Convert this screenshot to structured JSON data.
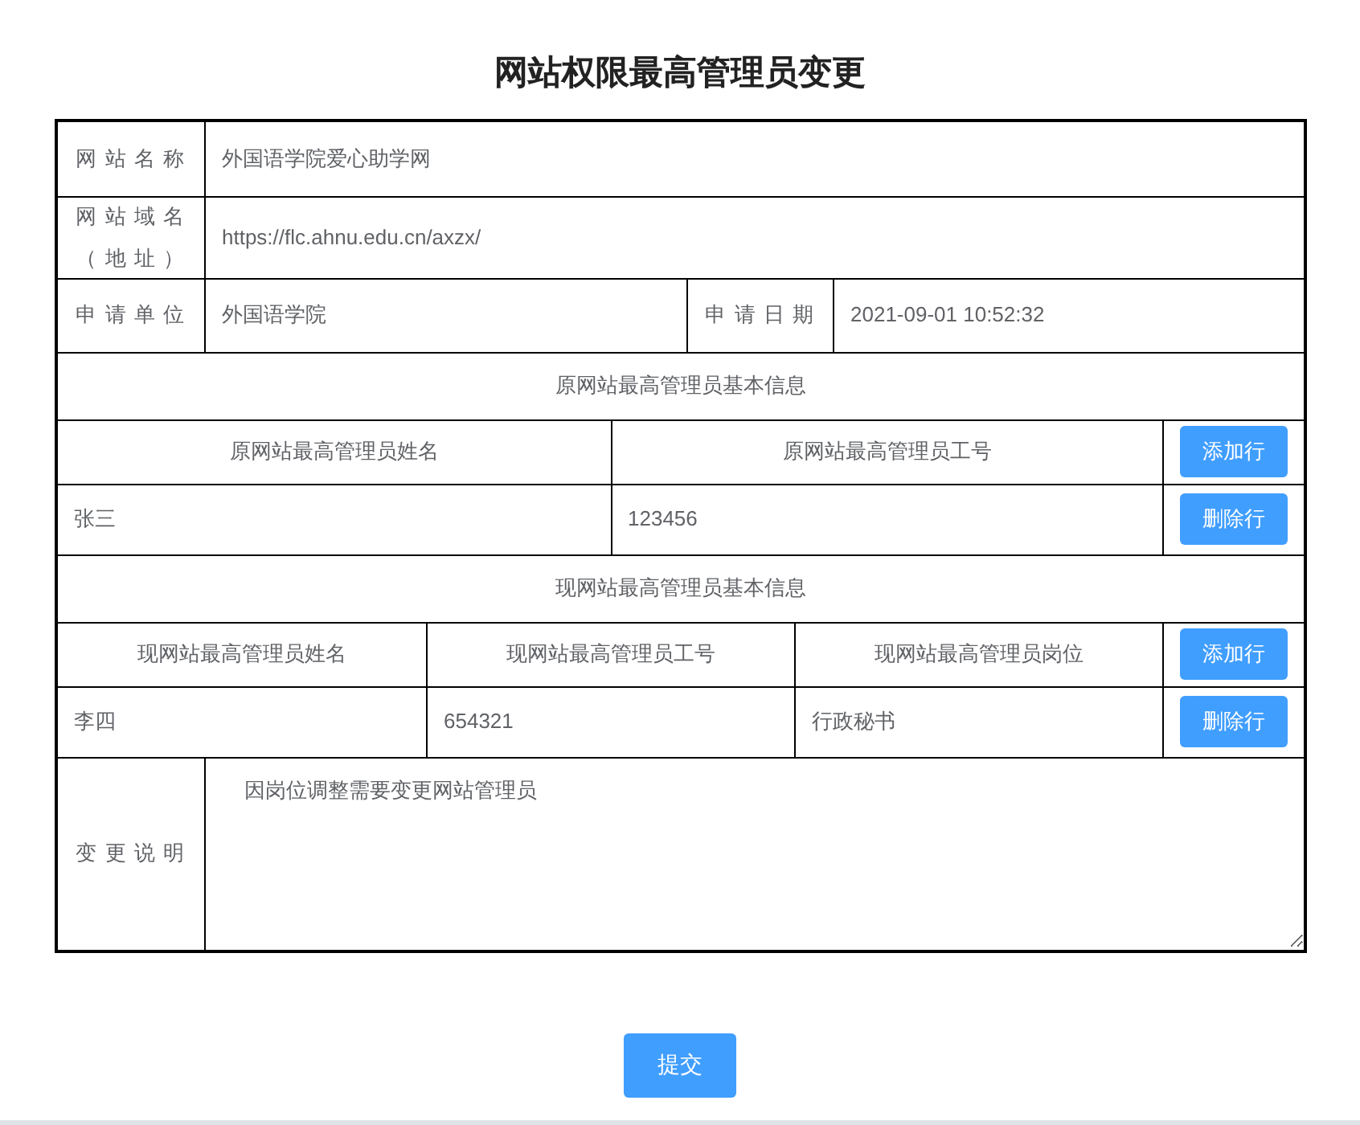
{
  "title": "网站权限最高管理员变更",
  "site_fields": [
    {
      "label": "网站名称",
      "value": "外国语学院爱心助学网"
    },
    {
      "label": "网站域名（地址）",
      "value": "https://flc.ahnu.edu.cn/axzx/"
    }
  ],
  "apply_row": [
    {
      "label": "申请单位",
      "value": "外国语学院"
    },
    {
      "label": "申请日期",
      "value": "2021-09-01 10:52:32"
    }
  ],
  "sections": [
    {
      "heading": "原网站最高管理员基本信息",
      "columns": [
        "原网站最高管理员姓名",
        "原网站最高管理员工号"
      ],
      "add_button": "添加行",
      "rows": [
        {
          "cells": [
            "张三",
            "123456"
          ],
          "delete_button": "删除行"
        }
      ]
    },
    {
      "heading": "现网站最高管理员基本信息",
      "columns": [
        "现网站最高管理员姓名",
        "现网站最高管理员工号",
        "现网站最高管理员岗位"
      ],
      "add_button": "添加行",
      "rows": [
        {
          "cells": [
            "李四",
            "654321",
            "行政秘书"
          ],
          "delete_button": "删除行"
        }
      ]
    }
  ],
  "change_note": {
    "label": "变更说明",
    "value": "因岗位调整需要变更网站管理员"
  },
  "submit": "提交"
}
